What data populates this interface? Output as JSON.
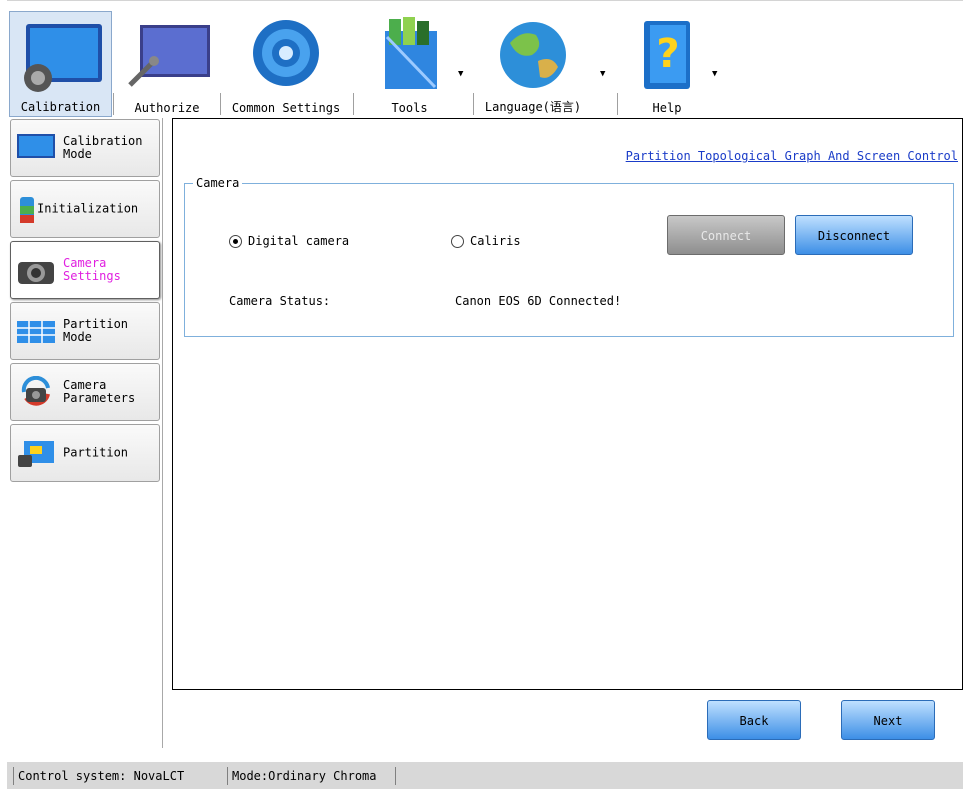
{
  "toolbar": {
    "items": [
      {
        "label": "Calibration",
        "icon": "calibration-icon",
        "active": true
      },
      {
        "label": "Authorize",
        "icon": "authorize-icon",
        "active": false
      },
      {
        "label": "Common Settings",
        "icon": "common-settings-icon",
        "active": false
      },
      {
        "label": "Tools",
        "icon": "tools-icon",
        "active": false,
        "dropdown": true
      },
      {
        "label": "Language(语言)",
        "icon": "language-globe-icon",
        "active": false,
        "dropdown": true
      },
      {
        "label": "Help",
        "icon": "help-book-icon",
        "active": false,
        "dropdown": true
      }
    ]
  },
  "nav": {
    "items": [
      {
        "label": "Calibration\nMode",
        "icon": "monitor-icon"
      },
      {
        "label": "Initialization",
        "icon": "database-icon"
      },
      {
        "label": "Camera\nSettings",
        "icon": "camera-icon",
        "active": true
      },
      {
        "label": "Partition\nMode",
        "icon": "grid-icon"
      },
      {
        "label": "Camera\nParameters",
        "icon": "camera-refresh-icon"
      },
      {
        "label": "Partition",
        "icon": "partition-screen-icon"
      }
    ]
  },
  "main": {
    "link": "Partition Topological Graph And Screen Control",
    "group_title": "Camera",
    "radio_digital": "Digital camera",
    "radio_caliris": "Caliris",
    "selected": "Digital camera",
    "connect": "Connect",
    "disconnect": "Disconnect",
    "status_label": "Camera Status:",
    "status_value": "Canon EOS 6D Connected!"
  },
  "footer": {
    "back": "Back",
    "next": "Next"
  },
  "statusbar": {
    "control": "Control system: NovaLCT",
    "mode": "Mode:Ordinary Chroma"
  },
  "colors": {
    "accent_blue": "#3d8fe6",
    "active_nav_text": "#e020e0",
    "link": "#1a3cc8"
  }
}
